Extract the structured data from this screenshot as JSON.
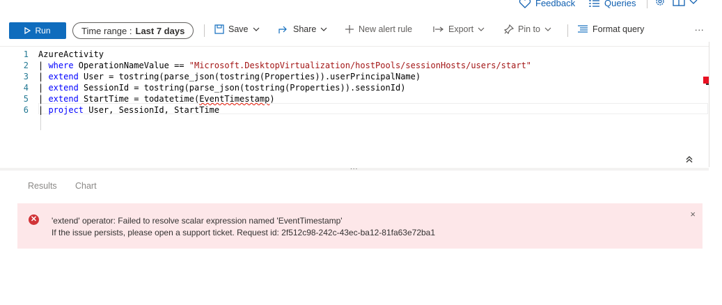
{
  "header": {
    "feedback_label": "Feedback",
    "queries_label": "Queries",
    "icons": [
      "heart-icon",
      "queries-list-icon",
      "gear-icon",
      "book-icon",
      "chevron-down-icon"
    ]
  },
  "toolbar": {
    "run_label": "Run",
    "time_range_prefix": "Time range :",
    "time_range_value": "Last 7 days",
    "save_label": "Save",
    "share_label": "Share",
    "new_alert_label": "New alert rule",
    "export_label": "Export",
    "pin_label": "Pin to",
    "format_label": "Format query",
    "more_label": "..."
  },
  "editor": {
    "lines": [
      {
        "num": "1",
        "parts": [
          {
            "t": "AzureActivity",
            "c": "plain"
          }
        ]
      },
      {
        "num": "2",
        "parts": [
          {
            "t": "| ",
            "c": "pipe"
          },
          {
            "t": "where",
            "c": "kw"
          },
          {
            "t": " OperationNameValue == ",
            "c": "plain"
          },
          {
            "t": "\"Microsoft.DesktopVirtualization/hostPools/sessionHosts/users/start\"",
            "c": "str"
          }
        ]
      },
      {
        "num": "3",
        "parts": [
          {
            "t": "| ",
            "c": "pipe"
          },
          {
            "t": "extend",
            "c": "kw"
          },
          {
            "t": " User = tostring(parse_json(tostring(Properties)).userPrincipalName)",
            "c": "plain"
          }
        ]
      },
      {
        "num": "4",
        "parts": [
          {
            "t": "| ",
            "c": "pipe"
          },
          {
            "t": "extend",
            "c": "kw"
          },
          {
            "t": " SessionId = tostring(parse_json(tostring(Properties)).sessionId)",
            "c": "plain"
          }
        ]
      },
      {
        "num": "5",
        "parts": [
          {
            "t": "| ",
            "c": "pipe"
          },
          {
            "t": "extend",
            "c": "kw"
          },
          {
            "t": " StartTime = todatetime(",
            "c": "plain"
          },
          {
            "t": "EventTimestamp",
            "c": "plain squig"
          },
          {
            "t": ")",
            "c": "plain"
          }
        ]
      },
      {
        "num": "6",
        "parts": [
          {
            "t": "| ",
            "c": "pipe"
          },
          {
            "t": "project",
            "c": "kw"
          },
          {
            "t": " User, SessionId, StartTime",
            "c": "plain"
          }
        ]
      }
    ],
    "splitter_dots": "...",
    "collapse_icon": "double-chevron-up-icon"
  },
  "results": {
    "tabs": [
      "Results",
      "Chart"
    ],
    "error": {
      "line1": "'extend' operator: Failed to resolve scalar expression named 'EventTimestamp'",
      "line2": "If the issue persists, please open a support ticket. Request id: 2f512c98-242c-43ec-ba12-81fa63e72ba1",
      "icon": "error-circle-icon",
      "close": "×"
    }
  },
  "colors": {
    "accent": "#0f6cbd",
    "error_bg": "#fde7e9",
    "error_icon": "#d13438",
    "keyword": "#0000ff",
    "string": "#a31515"
  }
}
